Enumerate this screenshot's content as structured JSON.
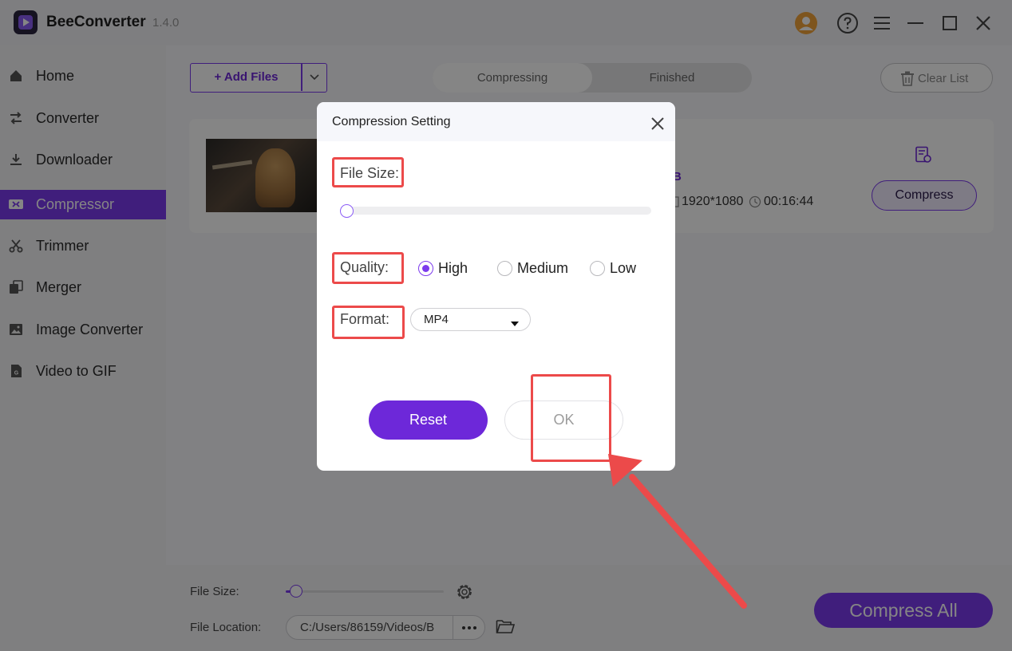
{
  "app": {
    "name": "BeeConverter",
    "version": "1.4.0"
  },
  "titlebar_icons": [
    "account-icon",
    "help-icon",
    "menu-icon",
    "minimize-icon",
    "maximize-icon",
    "close-icon"
  ],
  "sidebar": {
    "items": [
      {
        "label": "Home",
        "icon": "home-icon",
        "active": false
      },
      {
        "label": "Converter",
        "icon": "converter-icon",
        "active": false
      },
      {
        "label": "Downloader",
        "icon": "download-icon",
        "active": false
      },
      {
        "label": "Compressor",
        "icon": "compressor-icon",
        "active": true
      },
      {
        "label": "Trimmer",
        "icon": "scissors-icon",
        "active": false
      },
      {
        "label": "Merger",
        "icon": "merger-icon",
        "active": false
      },
      {
        "label": "Image Converter",
        "icon": "image-icon",
        "active": false
      },
      {
        "label": "Video to GIF",
        "icon": "gif-icon",
        "active": false
      }
    ]
  },
  "toolbar": {
    "add_files_label": "+ Add Files",
    "clear_list_label": "Clear List",
    "tabs": [
      {
        "label": "Compressing",
        "active": true
      },
      {
        "label": "Finished",
        "active": false
      }
    ]
  },
  "file_card": {
    "size_partial": "B",
    "resolution": "1920*1080",
    "duration": "00:16:44",
    "compress_label": "Compress"
  },
  "bottom_bar": {
    "file_size_label": "File Size:",
    "file_size_slider": 0.05,
    "file_location_label": "File Location:",
    "file_location_value": "C:/Users/86159/Videos/B",
    "compress_all_label": "Compress All"
  },
  "dialog": {
    "title": "Compression Setting",
    "file_size_label": "File Size:",
    "file_size_slider": 0.0,
    "quality_label": "Quality:",
    "quality_options": [
      {
        "label": "High",
        "selected": true
      },
      {
        "label": "Medium",
        "selected": false
      },
      {
        "label": "Low",
        "selected": false
      }
    ],
    "format_label": "Format:",
    "format_value": "MP4",
    "reset_label": "Reset",
    "ok_label": "OK"
  },
  "colors": {
    "accent": "#7c3aed",
    "accent_dark": "#6d28d9",
    "annotation_red": "#ec4a4a"
  }
}
